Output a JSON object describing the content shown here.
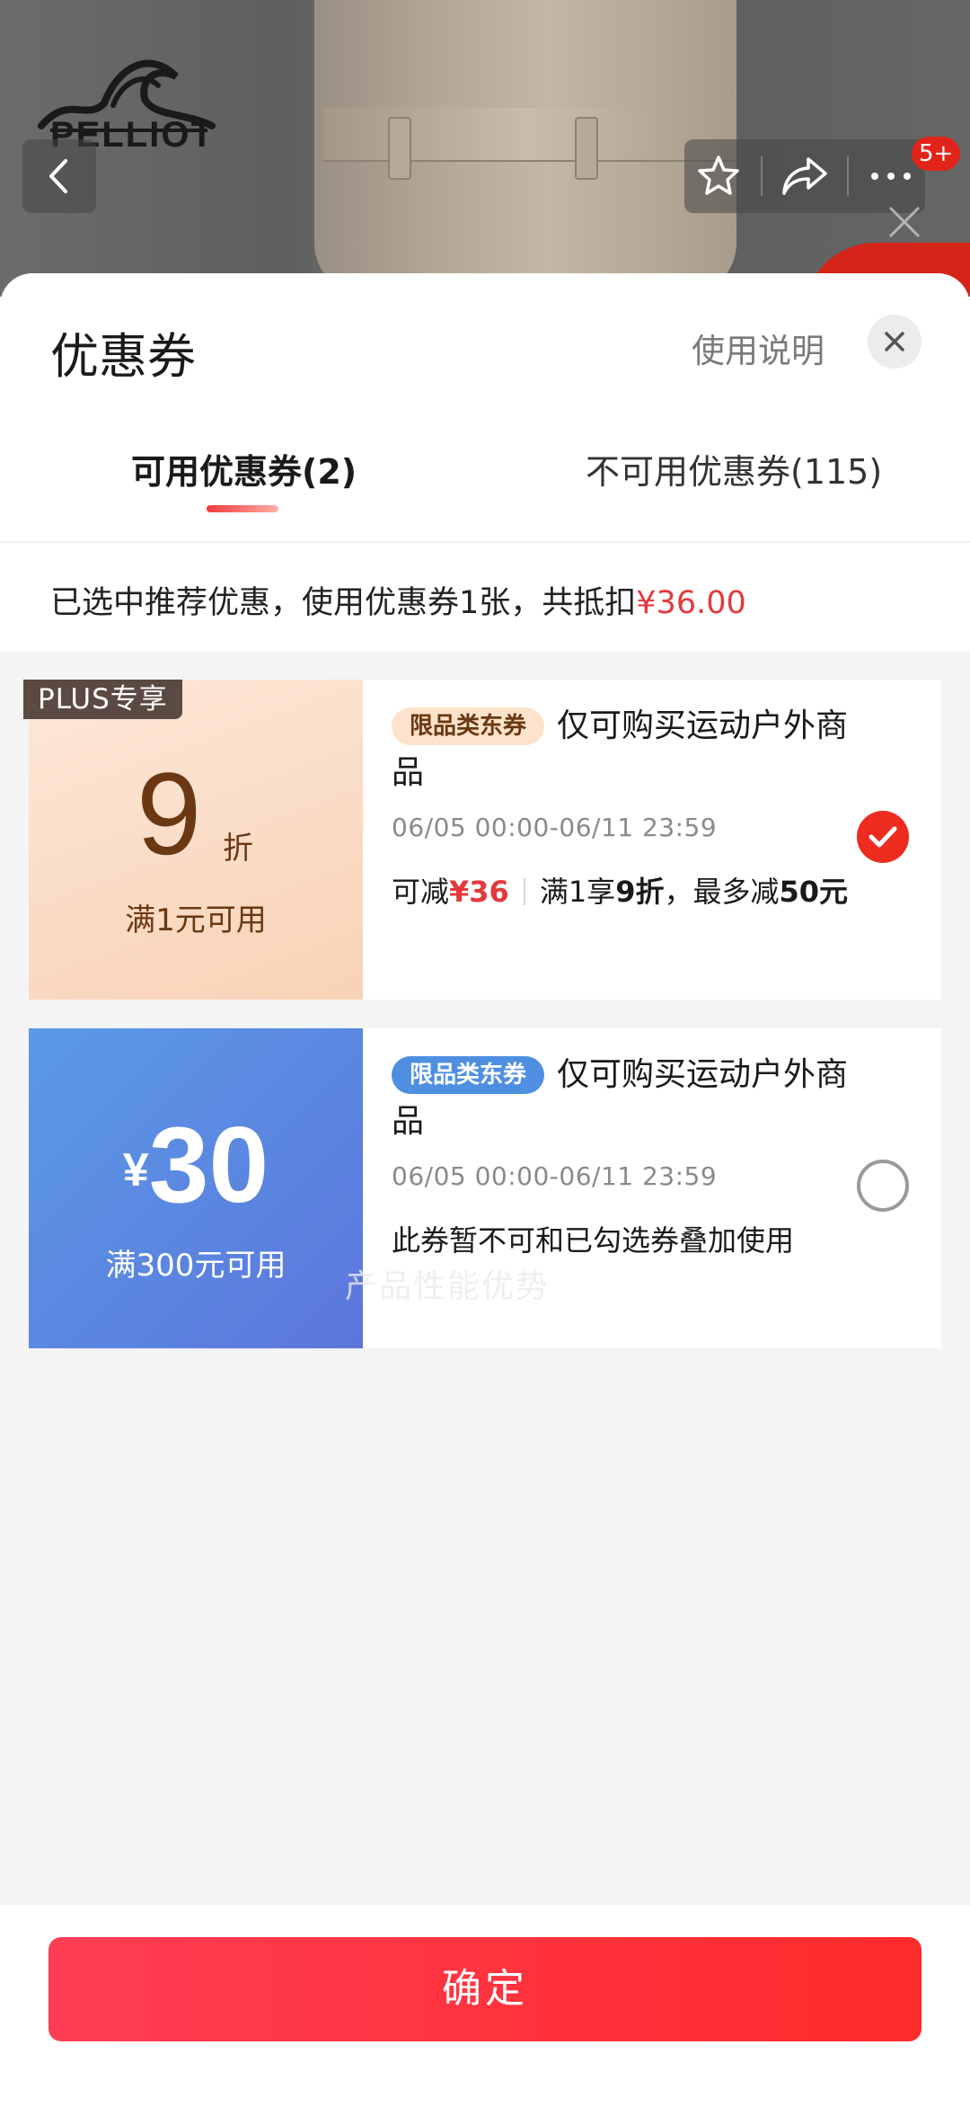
{
  "product_header": {
    "brand": "PELLIOT",
    "cart_badge": "5+"
  },
  "sheet": {
    "title": "优惠券",
    "usage_link": "使用说明"
  },
  "tabs": [
    {
      "label": "可用优惠券(2)",
      "active": true
    },
    {
      "label": "不可用优惠券(115)",
      "active": false
    }
  ],
  "summary": {
    "text": "已选中推荐优惠，使用优惠券1张，共抵扣",
    "amount": "¥36.00"
  },
  "coupons": [
    {
      "plus_tag": "PLUS专享",
      "value": "9",
      "unit": "折",
      "condition": "满1元可用",
      "category_tag": "限品类东券",
      "scope": "仅可购买运动户外商品",
      "validity": "06/05 00:00-06/11 23:59",
      "detail_prefix": "可减",
      "detail_amount": "¥36",
      "detail_rule_a": "满1享",
      "detail_rule_b": "9折",
      "detail_rule_c": "，最多减",
      "detail_rule_d": "50元",
      "selected": true
    },
    {
      "currency": "¥",
      "value": "30",
      "condition": "满300元可用",
      "category_tag": "限品类东券",
      "scope": "仅可购买运动户外商品",
      "validity": "06/05 00:00-06/11 23:59",
      "detail": "此券暂不可和已勾选券叠加使用",
      "selected": false
    }
  ],
  "watermark": "产品性能优势",
  "footer": {
    "confirm_label": "确定"
  },
  "colors": {
    "accent_red": "#e4393c",
    "button_red": "#ff2a2a",
    "coupon_blue": "#5a86e0",
    "coupon_peach": "#f8d2b6"
  }
}
